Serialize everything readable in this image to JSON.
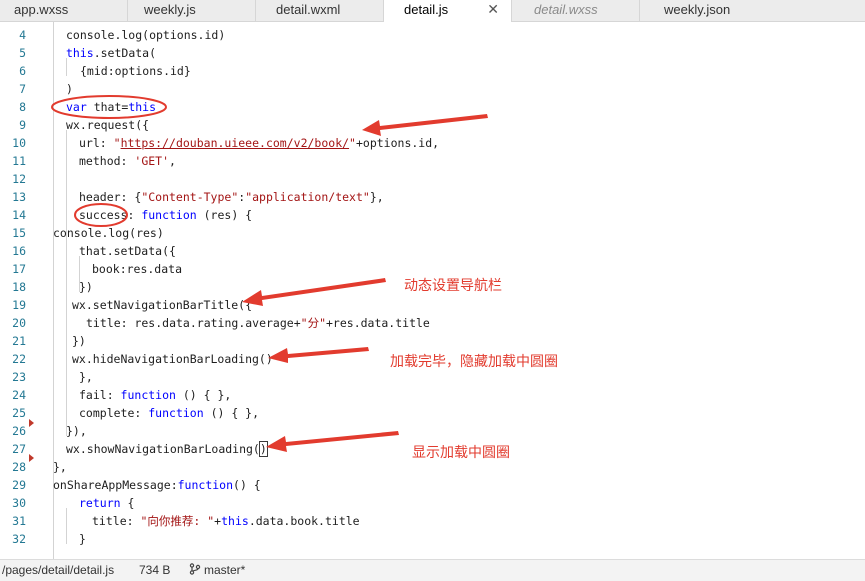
{
  "tabs": [
    {
      "label": "app.wxss"
    },
    {
      "label": "weekly.js"
    },
    {
      "label": "detail.wxml"
    },
    {
      "label": "detail.js",
      "close": "✕"
    },
    {
      "label": "detail.wxss"
    },
    {
      "label": "weekly.json"
    }
  ],
  "lines": [
    {
      "num": "4",
      "html": "<span>console.log(options.id)</span>"
    },
    {
      "num": "5",
      "html": "<span class=\"kw\">this</span>.setData("
    },
    {
      "num": "6",
      "html": "{mid:options.id}"
    },
    {
      "num": "7",
      "html": ")"
    },
    {
      "num": "8",
      "html": "<span class=\"kw\">var</span> that=<span class=\"kw\">this</span>"
    },
    {
      "num": "9",
      "html": "wx.request({"
    },
    {
      "num": "10",
      "html": "url: <span class=\"str\">\"</span><span class=\"url\">https://douban.uieee.com/v2/book/</span><span class=\"str\">\"</span>+options.id,"
    },
    {
      "num": "11",
      "html": "method: <span class=\"str\">'GET'</span>,"
    },
    {
      "num": "12",
      "html": ""
    },
    {
      "num": "13",
      "html": "header: {<span class=\"str\">\"Content-Type\"</span>:<span class=\"str\">\"application/text\"</span>},"
    },
    {
      "num": "14",
      "html": "success: <span class=\"kw\">function</span> (res) {"
    },
    {
      "num": "15",
      "html": "console.log(res)"
    },
    {
      "num": "16",
      "html": "that.setData({"
    },
    {
      "num": "17",
      "html": "book:res.data"
    },
    {
      "num": "18",
      "html": "})"
    },
    {
      "num": "19",
      "html": "wx.setNavigationBarTitle({"
    },
    {
      "num": "20",
      "html": "title: res.data.rating.average+<span class=\"str\">\"分\"</span>+res.data.title"
    },
    {
      "num": "21",
      "html": "})"
    },
    {
      "num": "22",
      "html": "wx.hideNavigationBarLoading()"
    },
    {
      "num": "23",
      "html": "},"
    },
    {
      "num": "24",
      "html": "fail: <span class=\"kw\">function</span> () { },"
    },
    {
      "num": "25",
      "html": "complete: <span class=\"kw\">function</span> () { },"
    },
    {
      "num": "26",
      "html": "}),"
    },
    {
      "num": "27",
      "html": "wx.showNavigationBarLoading(<span class=\"cursor-box\">)</span>"
    },
    {
      "num": "28",
      "html": "},"
    },
    {
      "num": "29",
      "html": "onShareAppMessage:<span class=\"kw\">function</span>() {"
    },
    {
      "num": "30",
      "html": "<span class=\"kw\">return</span> {"
    },
    {
      "num": "31",
      "html": "title: <span class=\"str\">\"向你推荐: \"</span>+<span class=\"kw\">this</span>.data.book.title"
    },
    {
      "num": "32",
      "html": "}"
    }
  ],
  "annotations": [
    {
      "label": "动态设置导航栏"
    },
    {
      "label": "加载完毕，隐藏加载中圆圈"
    },
    {
      "label": "显示加载中圆圈"
    }
  ],
  "colors": {
    "annotation": "#e23b2e"
  },
  "statusbar": {
    "path": "/pages/detail/detail.js",
    "size": "734 B",
    "branch_icon": "git-branch-icon",
    "branch": "master*"
  }
}
